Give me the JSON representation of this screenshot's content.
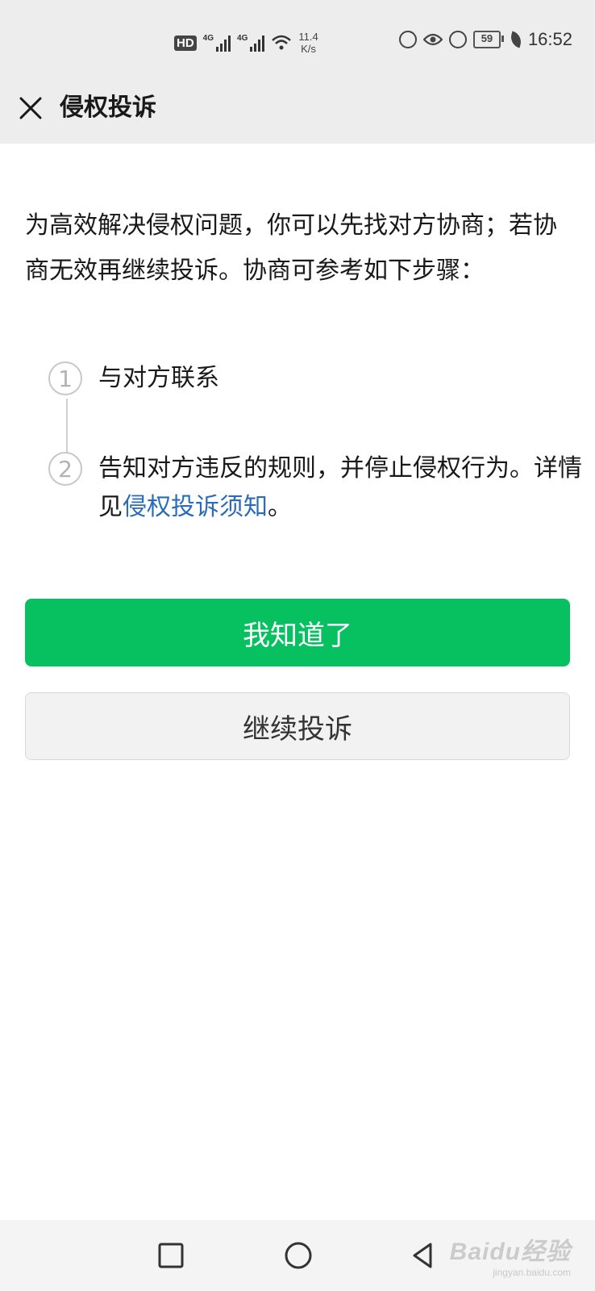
{
  "status_bar": {
    "hd_badge": "HD",
    "network_1": "4G",
    "network_2": "4G",
    "speed_value": "11.4",
    "speed_unit": "K/s",
    "battery": "59",
    "time": "16:52"
  },
  "header": {
    "title": "侵权投诉",
    "close_icon": "close-icon"
  },
  "intro": {
    "text": "为高效解决侵权问题，你可以先找对方协商；若协商无效再继续投诉。协商可参考如下步骤："
  },
  "steps": [
    {
      "number": "1",
      "text": "与对方联系"
    },
    {
      "number": "2",
      "text_before": "告知对方违反的规则，并停止侵权行为。详情见",
      "link": "侵权投诉须知",
      "text_after": "。"
    }
  ],
  "buttons": {
    "primary": "我知道了",
    "secondary": "继续投诉"
  },
  "colors": {
    "primary_green": "#07c160",
    "link_blue": "#2b6cb8",
    "header_bg": "#ededed"
  },
  "navbar": {
    "icons": [
      "recent-apps-icon",
      "home-icon",
      "back-icon"
    ],
    "watermark": "Baidu经验",
    "watermark_sub": "jingyan.baidu.com"
  }
}
